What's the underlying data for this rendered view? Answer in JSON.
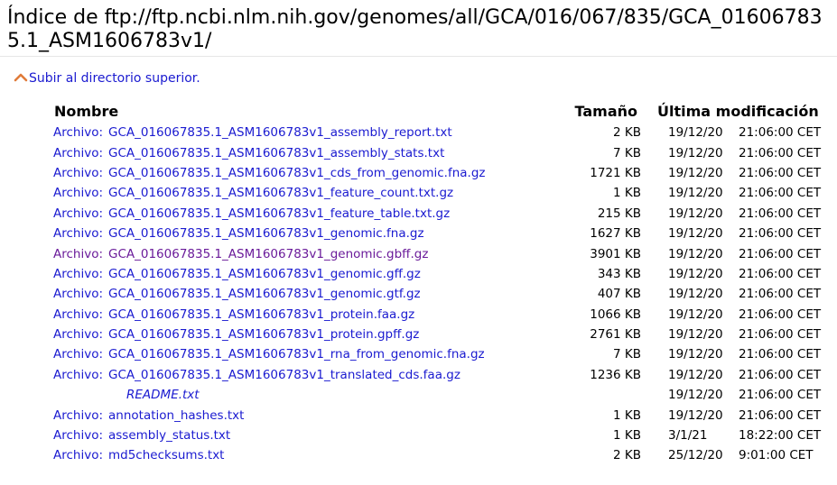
{
  "page": {
    "title": "Índice de ftp://ftp.ncbi.nlm.nih.gov/genomes/all/GCA/016/067/835/GCA_016067835.1_ASM1606783v1/",
    "up_link": "Subir al directorio superior."
  },
  "table": {
    "headers": {
      "name": "Nombre",
      "size": "Tamaño",
      "modified": "Última modificación"
    },
    "rows": [
      {
        "kind": "Archivo:",
        "name": "GCA_016067835.1_ASM1606783v1_assembly_report.txt",
        "size": "2 KB",
        "date": "19/12/20",
        "time": "21:06:00 CET"
      },
      {
        "kind": "Archivo:",
        "name": "GCA_016067835.1_ASM1606783v1_assembly_stats.txt",
        "size": "7 KB",
        "date": "19/12/20",
        "time": "21:06:00 CET"
      },
      {
        "kind": "Archivo:",
        "name": "GCA_016067835.1_ASM1606783v1_cds_from_genomic.fna.gz",
        "size": "1721 KB",
        "date": "19/12/20",
        "time": "21:06:00 CET"
      },
      {
        "kind": "Archivo:",
        "name": "GCA_016067835.1_ASM1606783v1_feature_count.txt.gz",
        "size": "1 KB",
        "date": "19/12/20",
        "time": "21:06:00 CET"
      },
      {
        "kind": "Archivo:",
        "name": "GCA_016067835.1_ASM1606783v1_feature_table.txt.gz",
        "size": "215 KB",
        "date": "19/12/20",
        "time": "21:06:00 CET"
      },
      {
        "kind": "Archivo:",
        "name": "GCA_016067835.1_ASM1606783v1_genomic.fna.gz",
        "size": "1627 KB",
        "date": "19/12/20",
        "time": "21:06:00 CET"
      },
      {
        "kind": "Archivo:",
        "name": "GCA_016067835.1_ASM1606783v1_genomic.gbff.gz",
        "size": "3901 KB",
        "date": "19/12/20",
        "time": "21:06:00 CET",
        "visited": true
      },
      {
        "kind": "Archivo:",
        "name": "GCA_016067835.1_ASM1606783v1_genomic.gff.gz",
        "size": "343 KB",
        "date": "19/12/20",
        "time": "21:06:00 CET"
      },
      {
        "kind": "Archivo:",
        "name": "GCA_016067835.1_ASM1606783v1_genomic.gtf.gz",
        "size": "407 KB",
        "date": "19/12/20",
        "time": "21:06:00 CET"
      },
      {
        "kind": "Archivo:",
        "name": "GCA_016067835.1_ASM1606783v1_protein.faa.gz",
        "size": "1066 KB",
        "date": "19/12/20",
        "time": "21:06:00 CET"
      },
      {
        "kind": "Archivo:",
        "name": "GCA_016067835.1_ASM1606783v1_protein.gpff.gz",
        "size": "2761 KB",
        "date": "19/12/20",
        "time": "21:06:00 CET"
      },
      {
        "kind": "Archivo:",
        "name": "GCA_016067835.1_ASM1606783v1_rna_from_genomic.fna.gz",
        "size": "7 KB",
        "date": "19/12/20",
        "time": "21:06:00 CET"
      },
      {
        "kind": "Archivo:",
        "name": "GCA_016067835.1_ASM1606783v1_translated_cds.faa.gz",
        "size": "1236 KB",
        "date": "19/12/20",
        "time": "21:06:00 CET"
      },
      {
        "kind": "",
        "name": "README.txt",
        "size": "",
        "date": "19/12/20",
        "time": "21:06:00 CET",
        "italic": true
      },
      {
        "kind": "Archivo:",
        "name": "annotation_hashes.txt",
        "size": "1 KB",
        "date": "19/12/20",
        "time": "21:06:00 CET"
      },
      {
        "kind": "Archivo:",
        "name": "assembly_status.txt",
        "size": "1 KB",
        "date": "3/1/21",
        "time": "18:22:00 CET"
      },
      {
        "kind": "Archivo:",
        "name": "md5checksums.txt",
        "size": "2 KB",
        "date": "25/12/20",
        "time": "9:01:00 CET"
      }
    ]
  },
  "icons": {
    "up_link": "chevron-up-icon"
  },
  "colors": {
    "link": "#1a1ad0",
    "visited_link": "#6a1b9a",
    "up_arrow": "#e07b39"
  }
}
